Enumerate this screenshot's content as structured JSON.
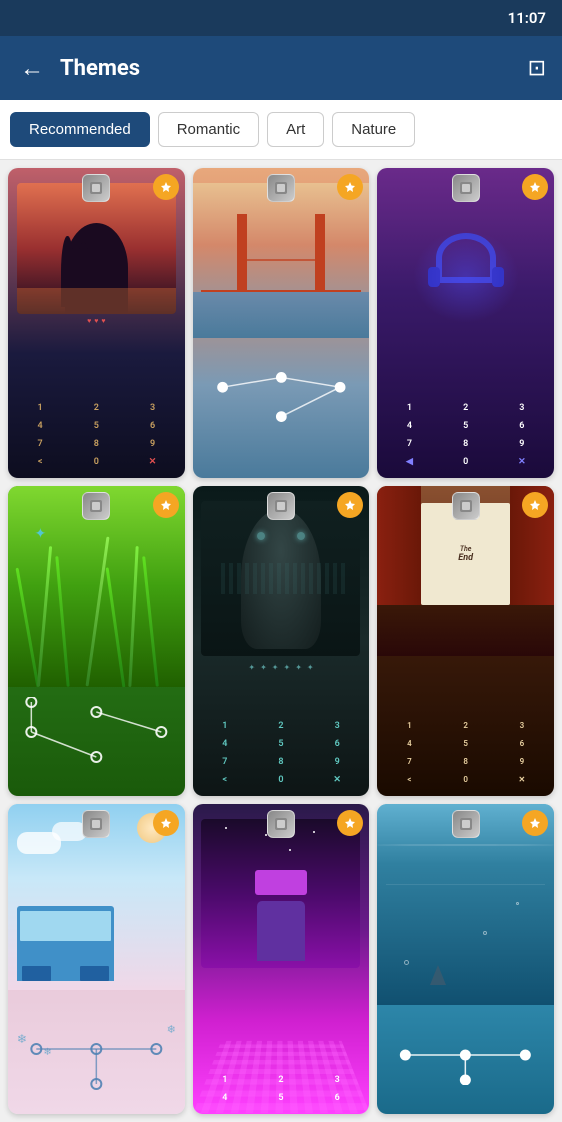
{
  "statusBar": {
    "time": "11:07"
  },
  "header": {
    "title": "Themes",
    "backLabel": "←",
    "saveIconLabel": "⊡"
  },
  "filters": [
    {
      "id": "recommended",
      "label": "Recommended",
      "active": true
    },
    {
      "id": "romantic",
      "label": "Romantic",
      "active": false
    },
    {
      "id": "art",
      "label": "Art",
      "active": false
    },
    {
      "id": "nature",
      "label": "Nature",
      "active": false
    }
  ],
  "themes": [
    {
      "id": 1,
      "name": "Couple City Night",
      "bgClass": "theme-bg-1",
      "type": "keypad",
      "keyStyle": "dark"
    },
    {
      "id": 2,
      "name": "Golden Gate Bridge",
      "bgClass": "theme-bg-2",
      "type": "pattern",
      "keyStyle": "light"
    },
    {
      "id": 3,
      "name": "Headphones Neon",
      "bgClass": "theme-bg-3",
      "type": "keypad",
      "keyStyle": "light"
    },
    {
      "id": 4,
      "name": "Green Nature",
      "bgClass": "theme-bg-4",
      "type": "pattern",
      "keyStyle": "light"
    },
    {
      "id": 5,
      "name": "Dark Grim",
      "bgClass": "theme-bg-5",
      "type": "keypad",
      "keyStyle": "teal"
    },
    {
      "id": 6,
      "name": "Cinema End",
      "bgClass": "theme-bg-6",
      "type": "keypad",
      "keyStyle": "cinema"
    },
    {
      "id": 7,
      "name": "Train Sky",
      "bgClass": "theme-bg-7",
      "type": "pattern",
      "keyStyle": "light"
    },
    {
      "id": 8,
      "name": "Neon VR",
      "bgClass": "theme-bg-8",
      "type": "keypad",
      "keyStyle": "light"
    },
    {
      "id": 9,
      "name": "Ocean Shark",
      "bgClass": "theme-bg-9",
      "type": "pattern",
      "keyStyle": "light"
    }
  ],
  "keypadRows": [
    [
      "1",
      "2",
      "3"
    ],
    [
      "4",
      "5",
      "6"
    ],
    [
      "7",
      "8",
      "9"
    ],
    [
      "<",
      "0",
      "✕"
    ]
  ]
}
